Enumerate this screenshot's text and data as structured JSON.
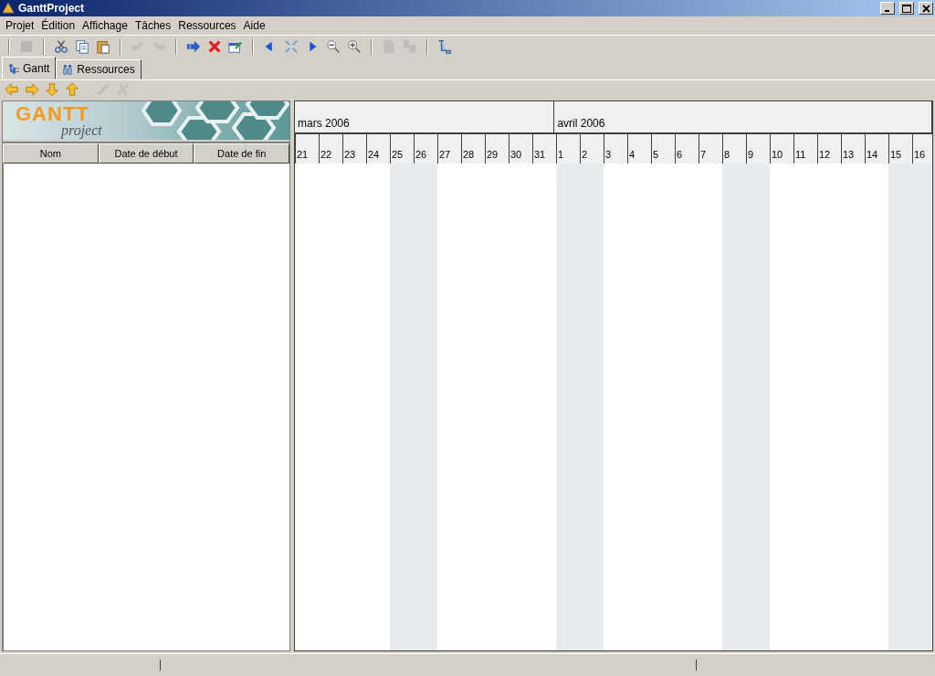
{
  "window": {
    "title": "GanttProject"
  },
  "menu": [
    "Projet",
    "Édition",
    "Affichage",
    "Tâches",
    "Ressources",
    "Aide"
  ],
  "toolbar": [
    {
      "disabled": true
    },
    {
      "disabled": false
    },
    {
      "disabled": false
    },
    {
      "disabled": false
    },
    {
      "disabled": true
    },
    {
      "disabled": true
    },
    {
      "disabled": false
    },
    {
      "disabled": false
    },
    {
      "disabled": false
    },
    {
      "disabled": false
    },
    {
      "disabled": false
    },
    {
      "disabled": false
    },
    {
      "disabled": false
    },
    {
      "disabled": false
    },
    {
      "disabled": true
    },
    {
      "disabled": true
    },
    {
      "disabled": false
    }
  ],
  "tabs": [
    {
      "label": "Gantt",
      "selected": true
    },
    {
      "label": "Ressources",
      "selected": false
    }
  ],
  "nav_toolbar": [
    {
      "disabled": false
    },
    {
      "disabled": false
    },
    {
      "disabled": false
    },
    {
      "disabled": false
    },
    {
      "disabled": true
    },
    {
      "disabled": true
    }
  ],
  "logo": {
    "title": "GANTT",
    "subtitle": "project"
  },
  "table": {
    "columns": [
      "Nom",
      "Date de début",
      "Date de fin"
    ]
  },
  "chart": {
    "months": [
      {
        "label": "mars 2006",
        "days": [
          {
            "label": "21",
            "weekend": false
          },
          {
            "label": "22",
            "weekend": false
          },
          {
            "label": "23",
            "weekend": false
          },
          {
            "label": "24",
            "weekend": false
          },
          {
            "label": "25",
            "weekend": true
          },
          {
            "label": "26",
            "weekend": true
          },
          {
            "label": "27",
            "weekend": false
          },
          {
            "label": "28",
            "weekend": false
          },
          {
            "label": "29",
            "weekend": false
          },
          {
            "label": "30",
            "weekend": false
          },
          {
            "label": "31",
            "weekend": false
          }
        ]
      },
      {
        "label": "avril 2006",
        "days": [
          {
            "label": "1",
            "weekend": true
          },
          {
            "label": "2",
            "weekend": true
          },
          {
            "label": "3",
            "weekend": false
          },
          {
            "label": "4",
            "weekend": false
          },
          {
            "label": "5",
            "weekend": false
          },
          {
            "label": "6",
            "weekend": false
          },
          {
            "label": "7",
            "weekend": false
          },
          {
            "label": "8",
            "weekend": true
          },
          {
            "label": "9",
            "weekend": true
          },
          {
            "label": "10",
            "weekend": false
          },
          {
            "label": "11",
            "weekend": false
          },
          {
            "label": "12",
            "weekend": false
          },
          {
            "label": "13",
            "weekend": false
          },
          {
            "label": "14",
            "weekend": false
          },
          {
            "label": "15",
            "weekend": true
          },
          {
            "label": "16",
            "weekend": true
          }
        ]
      }
    ]
  }
}
